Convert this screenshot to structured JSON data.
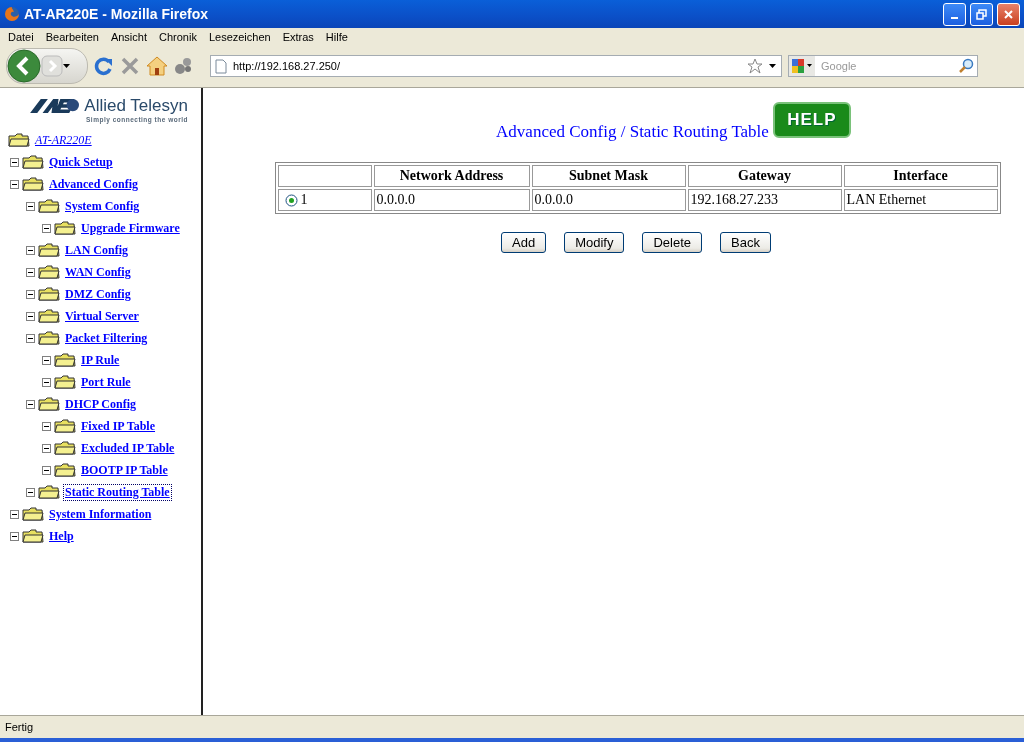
{
  "window": {
    "title": "AT-AR220E - Mozilla Firefox"
  },
  "menu": [
    "Datei",
    "Bearbeiten",
    "Ansicht",
    "Chronik",
    "Lesezeichen",
    "Extras",
    "Hilfe"
  ],
  "toolbar": {
    "url": "http://192.168.27.250/",
    "search_placeholder": "Google"
  },
  "logo": {
    "name": "Allied Telesyn",
    "tagline": "Simply connecting the world"
  },
  "tree": {
    "label": "AT-AR220E",
    "selected": false,
    "children": [
      {
        "label": "Quick Setup",
        "selected": false
      },
      {
        "label": "Advanced Config",
        "selected": false,
        "children": [
          {
            "label": "System Config",
            "selected": false,
            "children": [
              {
                "label": "Upgrade Firmware",
                "selected": false
              }
            ]
          },
          {
            "label": "LAN Config",
            "selected": false
          },
          {
            "label": "WAN Config",
            "selected": false
          },
          {
            "label": "DMZ Config",
            "selected": false
          },
          {
            "label": "Virtual Server",
            "selected": false
          },
          {
            "label": "Packet Filtering",
            "selected": false,
            "children": [
              {
                "label": "IP Rule",
                "selected": false
              },
              {
                "label": "Port Rule",
                "selected": false
              }
            ]
          },
          {
            "label": "DHCP Config",
            "selected": false,
            "children": [
              {
                "label": "Fixed IP Table",
                "selected": false
              },
              {
                "label": "Excluded IP Table",
                "selected": false
              },
              {
                "label": "BOOTP IP Table",
                "selected": false
              }
            ]
          },
          {
            "label": "Static Routing Table",
            "selected": true
          }
        ]
      },
      {
        "label": "System Information",
        "selected": false
      },
      {
        "label": "Help",
        "selected": false
      }
    ]
  },
  "page": {
    "title": "Advanced Config / Static Routing Table",
    "help_button": "HELP",
    "table": {
      "columns": [
        "Network Address",
        "Subnet Mask",
        "Gateway",
        "Interface"
      ],
      "rows": [
        {
          "selected": true,
          "index": "1",
          "cells": [
            "0.0.0.0",
            "0.0.0.0",
            "192.168.27.233",
            "LAN Ethernet"
          ]
        }
      ]
    },
    "buttons": [
      "Add",
      "Modify",
      "Delete",
      "Back"
    ]
  },
  "status_bar": "Fertig"
}
